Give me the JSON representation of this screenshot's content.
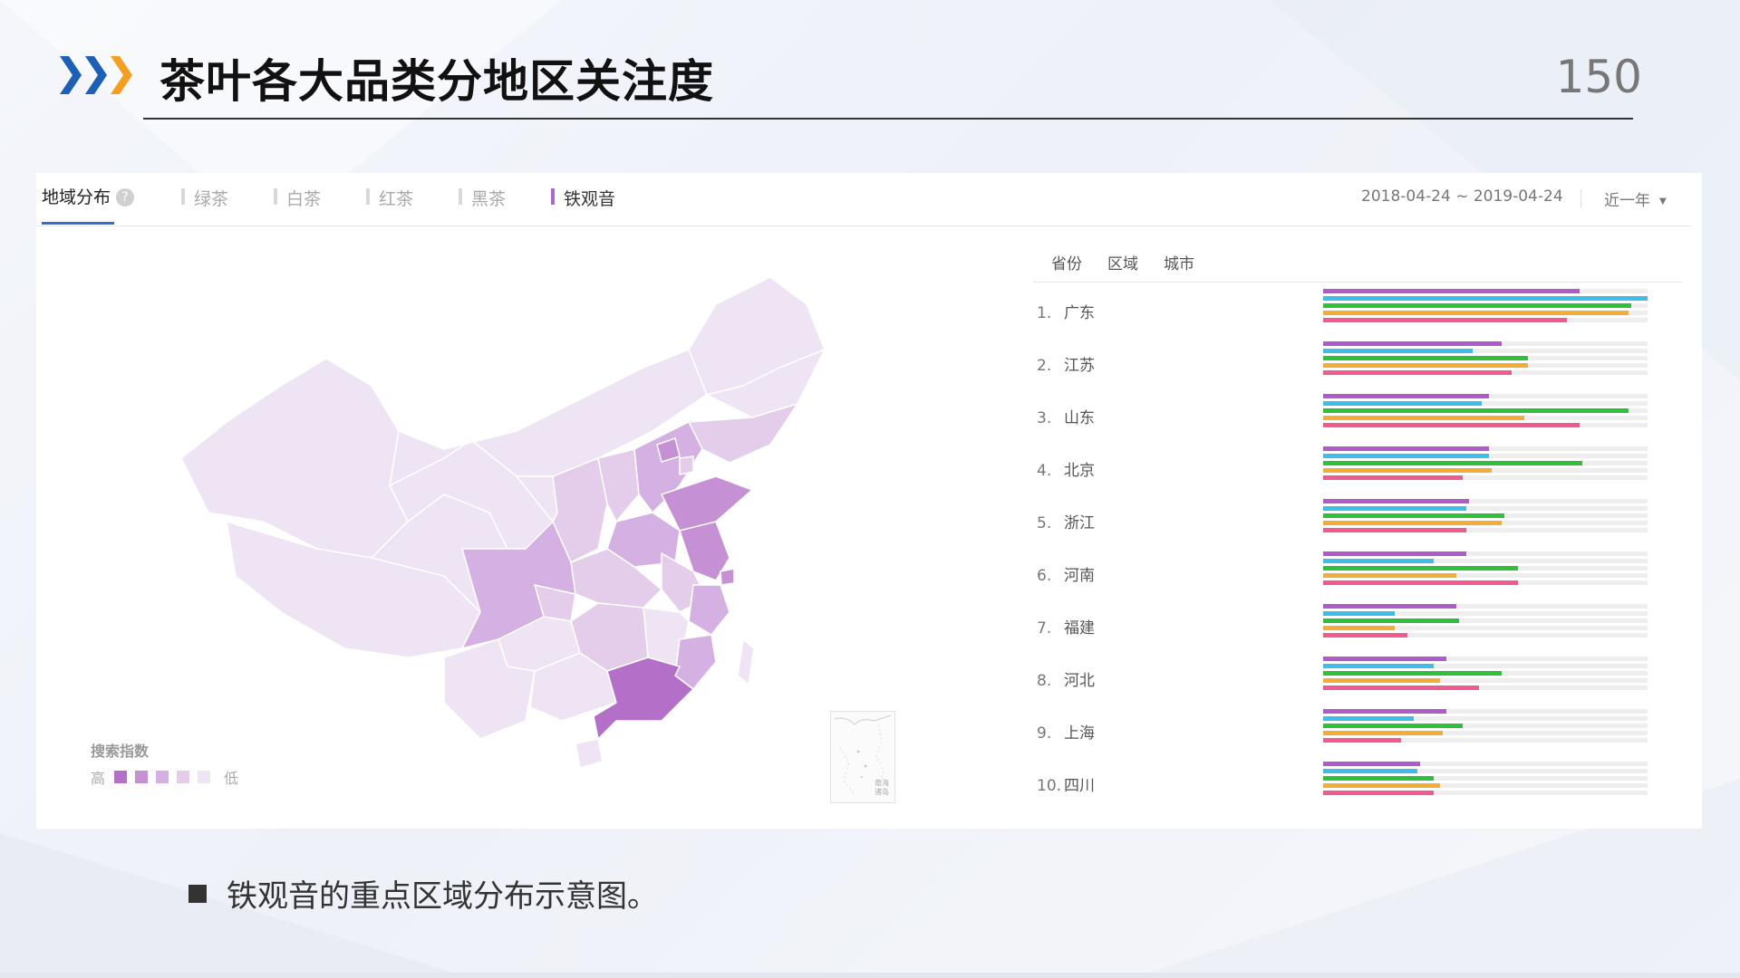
{
  "header": {
    "title": "茶叶各大品类分地区关注度",
    "page_number": "150"
  },
  "panel": {
    "main_tab": "地域分布",
    "help_glyph": "?",
    "categories": [
      {
        "label": "绿茶",
        "active": false
      },
      {
        "label": "白茶",
        "active": false
      },
      {
        "label": "红茶",
        "active": false
      },
      {
        "label": "黑茶",
        "active": false
      },
      {
        "label": "铁观音",
        "active": true
      }
    ],
    "date_range": "2018-04-24 ~ 2019-04-24",
    "range_select": "近一年",
    "subtabs": [
      "省份",
      "区域",
      "城市"
    ]
  },
  "legend": {
    "title": "搜索指数",
    "high": "高",
    "low": "低",
    "colors": [
      "#b46fc9",
      "#c690d5",
      "#d5b0e2",
      "#e3cdeb",
      "#efe4f4"
    ]
  },
  "inset_label": "南海\n诸岛",
  "colors": {
    "bar_colors": [
      "#b05cc8",
      "#3fbde8",
      "#2fbf3a",
      "#f2ac3a",
      "#ef5a8f"
    ],
    "track": "#eeeeee",
    "accent": "#2f6dd6"
  },
  "chart_data": {
    "type": "bar",
    "categories": [
      "广东",
      "江苏",
      "山东",
      "北京",
      "浙江",
      "河南",
      "福建",
      "河北",
      "上海",
      "四川"
    ],
    "xlim": [
      0,
      1
    ],
    "series": [
      {
        "values": [
          0.79,
          0.55,
          0.51,
          0.51,
          0.45,
          0.44,
          0.41,
          0.38,
          0.38,
          0.3
        ]
      },
      {
        "values": [
          1.0,
          0.46,
          0.49,
          0.51,
          0.44,
          0.34,
          0.22,
          0.34,
          0.28,
          0.29
        ]
      },
      {
        "values": [
          0.95,
          0.63,
          0.94,
          0.8,
          0.56,
          0.6,
          0.42,
          0.55,
          0.43,
          0.34
        ]
      },
      {
        "values": [
          0.94,
          0.63,
          0.62,
          0.52,
          0.55,
          0.41,
          0.22,
          0.36,
          0.37,
          0.36
        ]
      },
      {
        "values": [
          0.75,
          0.58,
          0.79,
          0.43,
          0.44,
          0.6,
          0.26,
          0.48,
          0.24,
          0.34
        ]
      }
    ],
    "rank_numbers": [
      "1.",
      "2.",
      "3.",
      "4.",
      "5.",
      "6.",
      "7.",
      "8.",
      "9.",
      "10."
    ]
  },
  "map": {
    "levels": {
      "广东": 0,
      "江苏": 1,
      "山东": 1,
      "北京": 1,
      "浙江": 2,
      "河南": 2,
      "福建": 2,
      "河北": 2,
      "上海": 1,
      "四川": 2,
      "天津": 3,
      "湖北": 3,
      "湖南": 3,
      "安徽": 3,
      "江西": 4,
      "广西": 4,
      "云南": 4,
      "贵州": 4,
      "重庆": 3,
      "陕西": 3,
      "山西": 3,
      "辽宁": 3,
      "吉林": 4,
      "黑龙江": 4,
      "内蒙古": 4,
      "甘肃": 4,
      "宁夏": 4,
      "青海": 4,
      "新疆": 4,
      "西藏": 4,
      "海南": 4,
      "台湾": 4
    }
  },
  "caption": "铁观音的重点区域分布示意图。"
}
